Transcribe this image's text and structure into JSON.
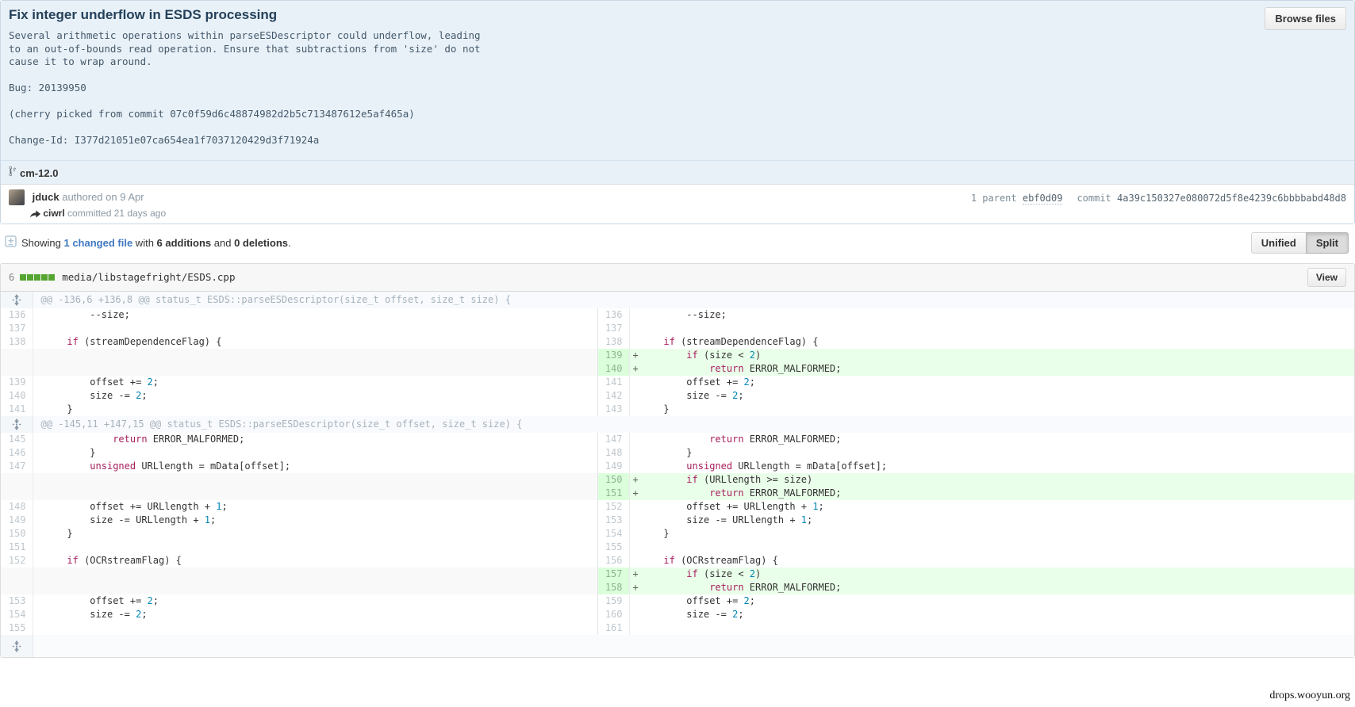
{
  "commit": {
    "title": "Fix integer underflow in ESDS processing",
    "description": "Several arithmetic operations within parseESDescriptor could underflow, leading\nto an out-of-bounds read operation. Ensure that subtractions from 'size' do not\ncause it to wrap around.\n\nBug: 20139950\n\n(cherry picked from commit 07c0f59d6c48874982d2b5c713487612e5af465a)\n\nChange-Id: I377d21051e07ca654ea1f7037120429d3f71924a",
    "browse_files_label": "Browse files",
    "branch": "cm-12.0",
    "author": "jduck",
    "authored_text": "authored on 9 Apr",
    "committer": "ciwrl",
    "committed_text": "committed 21 days ago",
    "parent_label": "1 parent ",
    "parent_sha": "ebf0d09",
    "commit_label": "commit ",
    "commit_sha": "4a39c150327e080072d5f8e4239c6bbbbabd48d8"
  },
  "toolbar": {
    "showing_prefix": "Showing ",
    "changed_file_link": "1 changed file",
    "with_text": " with ",
    "additions": "6 additions",
    "and_text": " and ",
    "deletions": "0 deletions",
    "period": ".",
    "unified_label": "Unified",
    "split_label": "Split"
  },
  "file": {
    "changes_count": "6",
    "diffstat_blocks": 5,
    "path": "media/libstagefright/ESDS.cpp",
    "view_label": "View"
  },
  "colors": {
    "addition_bg": "#eaffea",
    "addition_gutter_bg": "#dbffdb",
    "keyword": "#a71d5d",
    "number": "#0086b3",
    "diffstat_green": "#55a532",
    "link": "#4078c0"
  },
  "icons": {
    "branch": "git-branch-icon",
    "unfold": "unfold-icon",
    "committed_arrow": "arrow-right-icon",
    "showing": "file-diff-icon"
  },
  "watermark": "drops.wooyun.org",
  "diff": {
    "hunks": [
      {
        "header": "@@ -136,6 +136,8 @@ status_t ESDS::parseESDescriptor(size_t offset, size_t size) {",
        "rows": [
          {
            "l": {
              "n": "136",
              "k": "c",
              "t": [
                [
                  "p",
                  "        --size;"
                ]
              ]
            },
            "r": {
              "n": "136",
              "k": "c",
              "t": [
                [
                  "p",
                  "        --size;"
                ]
              ]
            }
          },
          {
            "l": {
              "n": "137",
              "k": "c",
              "t": []
            },
            "r": {
              "n": "137",
              "k": "c",
              "t": []
            }
          },
          {
            "l": {
              "n": "138",
              "k": "c",
              "t": [
                [
                  "p",
                  "    "
                ],
                [
                  "k",
                  "if"
                ],
                [
                  "p",
                  " (streamDependenceFlag) {"
                ]
              ]
            },
            "r": {
              "n": "138",
              "k": "c",
              "t": [
                [
                  "p",
                  "    "
                ],
                [
                  "k",
                  "if"
                ],
                [
                  "p",
                  " (streamDependenceFlag) {"
                ]
              ]
            }
          },
          {
            "l": {
              "k": "e"
            },
            "r": {
              "n": "139",
              "k": "a",
              "t": [
                [
                  "p",
                  "        "
                ],
                [
                  "k",
                  "if"
                ],
                [
                  "p",
                  " (size < "
                ],
                [
                  "n",
                  "2"
                ],
                [
                  "p",
                  ")"
                ]
              ]
            }
          },
          {
            "l": {
              "k": "e"
            },
            "r": {
              "n": "140",
              "k": "a",
              "t": [
                [
                  "p",
                  "            "
                ],
                [
                  "k",
                  "return"
                ],
                [
                  "p",
                  " ERROR_MALFORMED;"
                ]
              ]
            }
          },
          {
            "l": {
              "n": "139",
              "k": "c",
              "t": [
                [
                  "p",
                  "        offset += "
                ],
                [
                  "n",
                  "2"
                ],
                [
                  "p",
                  ";"
                ]
              ]
            },
            "r": {
              "n": "141",
              "k": "c",
              "t": [
                [
                  "p",
                  "        offset += "
                ],
                [
                  "n",
                  "2"
                ],
                [
                  "p",
                  ";"
                ]
              ]
            }
          },
          {
            "l": {
              "n": "140",
              "k": "c",
              "t": [
                [
                  "p",
                  "        size -= "
                ],
                [
                  "n",
                  "2"
                ],
                [
                  "p",
                  ";"
                ]
              ]
            },
            "r": {
              "n": "142",
              "k": "c",
              "t": [
                [
                  "p",
                  "        size -= "
                ],
                [
                  "n",
                  "2"
                ],
                [
                  "p",
                  ";"
                ]
              ]
            }
          },
          {
            "l": {
              "n": "141",
              "k": "c",
              "t": [
                [
                  "p",
                  "    }"
                ]
              ]
            },
            "r": {
              "n": "143",
              "k": "c",
              "t": [
                [
                  "p",
                  "    }"
                ]
              ]
            }
          }
        ]
      },
      {
        "header": "@@ -145,11 +147,15 @@ status_t ESDS::parseESDescriptor(size_t offset, size_t size) {",
        "rows": [
          {
            "l": {
              "n": "145",
              "k": "c",
              "t": [
                [
                  "p",
                  "            "
                ],
                [
                  "k",
                  "return"
                ],
                [
                  "p",
                  " ERROR_MALFORMED;"
                ]
              ]
            },
            "r": {
              "n": "147",
              "k": "c",
              "t": [
                [
                  "p",
                  "            "
                ],
                [
                  "k",
                  "return"
                ],
                [
                  "p",
                  " ERROR_MALFORMED;"
                ]
              ]
            }
          },
          {
            "l": {
              "n": "146",
              "k": "c",
              "t": [
                [
                  "p",
                  "        }"
                ]
              ]
            },
            "r": {
              "n": "148",
              "k": "c",
              "t": [
                [
                  "p",
                  "        }"
                ]
              ]
            }
          },
          {
            "l": {
              "n": "147",
              "k": "c",
              "t": [
                [
                  "p",
                  "        "
                ],
                [
                  "k",
                  "unsigned"
                ],
                [
                  "p",
                  " URLlength = mData[offset];"
                ]
              ]
            },
            "r": {
              "n": "149",
              "k": "c",
              "t": [
                [
                  "p",
                  "        "
                ],
                [
                  "k",
                  "unsigned"
                ],
                [
                  "p",
                  " URLlength = mData[offset];"
                ]
              ]
            }
          },
          {
            "l": {
              "k": "e"
            },
            "r": {
              "n": "150",
              "k": "a",
              "t": [
                [
                  "p",
                  "        "
                ],
                [
                  "k",
                  "if"
                ],
                [
                  "p",
                  " (URLlength >= size)"
                ]
              ]
            }
          },
          {
            "l": {
              "k": "e"
            },
            "r": {
              "n": "151",
              "k": "a",
              "t": [
                [
                  "p",
                  "            "
                ],
                [
                  "k",
                  "return"
                ],
                [
                  "p",
                  " ERROR_MALFORMED;"
                ]
              ]
            }
          },
          {
            "l": {
              "n": "148",
              "k": "c",
              "t": [
                [
                  "p",
                  "        offset += URLlength + "
                ],
                [
                  "n",
                  "1"
                ],
                [
                  "p",
                  ";"
                ]
              ]
            },
            "r": {
              "n": "152",
              "k": "c",
              "t": [
                [
                  "p",
                  "        offset += URLlength + "
                ],
                [
                  "n",
                  "1"
                ],
                [
                  "p",
                  ";"
                ]
              ]
            }
          },
          {
            "l": {
              "n": "149",
              "k": "c",
              "t": [
                [
                  "p",
                  "        size -= URLlength + "
                ],
                [
                  "n",
                  "1"
                ],
                [
                  "p",
                  ";"
                ]
              ]
            },
            "r": {
              "n": "153",
              "k": "c",
              "t": [
                [
                  "p",
                  "        size -= URLlength + "
                ],
                [
                  "n",
                  "1"
                ],
                [
                  "p",
                  ";"
                ]
              ]
            }
          },
          {
            "l": {
              "n": "150",
              "k": "c",
              "t": [
                [
                  "p",
                  "    }"
                ]
              ]
            },
            "r": {
              "n": "154",
              "k": "c",
              "t": [
                [
                  "p",
                  "    }"
                ]
              ]
            }
          },
          {
            "l": {
              "n": "151",
              "k": "c",
              "t": []
            },
            "r": {
              "n": "155",
              "k": "c",
              "t": []
            }
          },
          {
            "l": {
              "n": "152",
              "k": "c",
              "t": [
                [
                  "p",
                  "    "
                ],
                [
                  "k",
                  "if"
                ],
                [
                  "p",
                  " (OCRstreamFlag) {"
                ]
              ]
            },
            "r": {
              "n": "156",
              "k": "c",
              "t": [
                [
                  "p",
                  "    "
                ],
                [
                  "k",
                  "if"
                ],
                [
                  "p",
                  " (OCRstreamFlag) {"
                ]
              ]
            }
          },
          {
            "l": {
              "k": "e"
            },
            "r": {
              "n": "157",
              "k": "a",
              "t": [
                [
                  "p",
                  "        "
                ],
                [
                  "k",
                  "if"
                ],
                [
                  "p",
                  " (size < "
                ],
                [
                  "n",
                  "2"
                ],
                [
                  "p",
                  ")"
                ]
              ]
            }
          },
          {
            "l": {
              "k": "e"
            },
            "r": {
              "n": "158",
              "k": "a",
              "t": [
                [
                  "p",
                  "            "
                ],
                [
                  "k",
                  "return"
                ],
                [
                  "p",
                  " ERROR_MALFORMED;"
                ]
              ]
            }
          },
          {
            "l": {
              "n": "153",
              "k": "c",
              "t": [
                [
                  "p",
                  "        offset += "
                ],
                [
                  "n",
                  "2"
                ],
                [
                  "p",
                  ";"
                ]
              ]
            },
            "r": {
              "n": "159",
              "k": "c",
              "t": [
                [
                  "p",
                  "        offset += "
                ],
                [
                  "n",
                  "2"
                ],
                [
                  "p",
                  ";"
                ]
              ]
            }
          },
          {
            "l": {
              "n": "154",
              "k": "c",
              "t": [
                [
                  "p",
                  "        size -= "
                ],
                [
                  "n",
                  "2"
                ],
                [
                  "p",
                  ";"
                ]
              ]
            },
            "r": {
              "n": "160",
              "k": "c",
              "t": [
                [
                  "p",
                  "        size -= "
                ],
                [
                  "n",
                  "2"
                ],
                [
                  "p",
                  ";"
                ]
              ]
            }
          },
          {
            "l": {
              "n": "155",
              "k": "c",
              "t": []
            },
            "r": {
              "n": "161",
              "k": "c",
              "t": []
            }
          }
        ]
      }
    ]
  }
}
